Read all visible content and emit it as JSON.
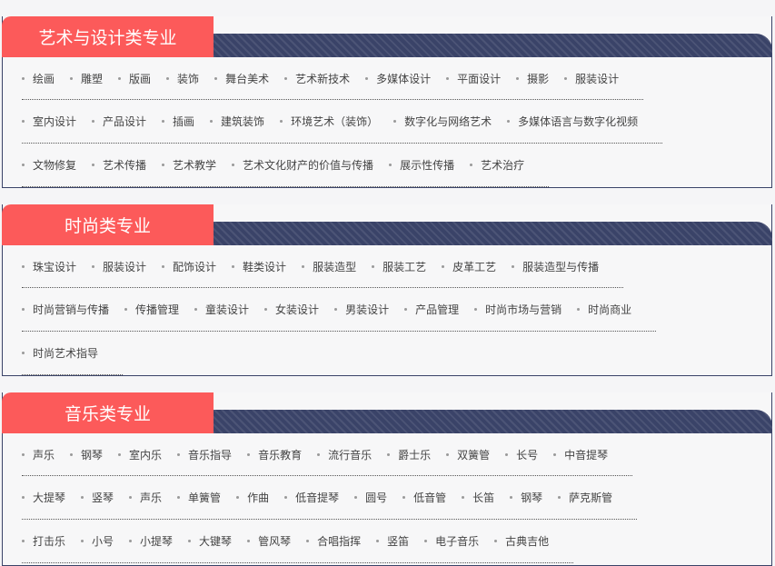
{
  "sections": [
    {
      "title": "艺术与设计类专业",
      "rows": [
        [
          "绘画",
          "雕塑",
          "版画",
          "装饰",
          "舞台美术",
          "艺术新技术",
          "多媒体设计",
          "平面设计",
          "摄影",
          "服装设计"
        ],
        [
          "室内设计",
          "产品设计",
          "插画",
          "建筑装饰",
          "环境艺术（装饰）",
          "数字化与网络艺术",
          "多媒体语言与数字化视频"
        ],
        [
          "文物修复",
          "艺术传播",
          "艺术教学",
          "艺术文化财产的价值与传播",
          "展示性传播",
          "艺术治疗"
        ]
      ]
    },
    {
      "title": "时尚类专业",
      "rows": [
        [
          "珠宝设计",
          "服装设计",
          "配饰设计",
          "鞋类设计",
          "服装造型",
          "服装工艺",
          "皮革工艺",
          "服装造型与传播"
        ],
        [
          "时尚营销与传播",
          "传播管理",
          "童装设计",
          "女装设计",
          "男装设计",
          "产品管理",
          "时尚市场与营销",
          "时尚商业"
        ],
        [
          "时尚艺术指导"
        ]
      ]
    },
    {
      "title": "音乐类专业",
      "rows": [
        [
          "声乐",
          "钢琴",
          "室内乐",
          "音乐指导",
          "音乐教育",
          "流行音乐",
          "爵士乐",
          "双簧管",
          "长号",
          "中音提琴"
        ],
        [
          "大提琴",
          "竖琴",
          "声乐",
          "单簧管",
          "作曲",
          "低音提琴",
          "圆号",
          "低音管",
          "长笛",
          "钢琴",
          "萨克斯管"
        ],
        [
          "打击乐",
          "小号",
          "小提琴",
          "大键琴",
          "管风琴",
          "合唱指挥",
          "竖笛",
          "电子音乐",
          "古典吉他"
        ]
      ]
    }
  ]
}
